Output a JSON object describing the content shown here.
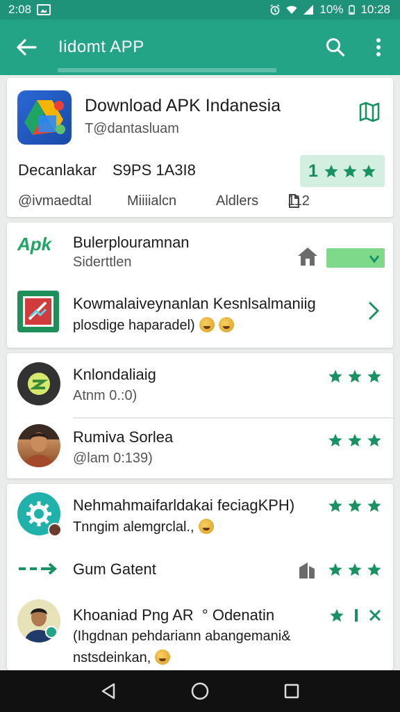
{
  "status_bar": {
    "time": "2:08",
    "battery": "10%",
    "clock": "10:28"
  },
  "appbar": {
    "title": "Iidomt APP"
  },
  "app": {
    "name": "Download APK Indanesia",
    "developer": "T@dantasluam",
    "stat_label": "Decanlakar",
    "stat_value": "S9PS 1A3I8",
    "rating": "1",
    "meta": [
      "@ivmaedtal",
      "Miiiialcn",
      "Aldlers",
      "112"
    ]
  },
  "section1": {
    "item1": {
      "badge": "Apk",
      "title": "Bulerplouramnan",
      "sub": "Siderttlen"
    },
    "item2": {
      "title": "Kowmalaiveynanlan Kesnlsalmaniig",
      "sub": "plosdige haparadel)"
    }
  },
  "section2": {
    "item1": {
      "title": "Knlondaliaig",
      "sub": "Atnm 0.:0)"
    },
    "item2": {
      "title": "Rumiva  Sorlea",
      "sub": "@lam 0:139)"
    }
  },
  "section3": {
    "item1": {
      "title": "Nehmahmaifarldakai feciagKPH)",
      "sub": "Tnngim alemgrclal.,"
    },
    "item2": {
      "title": "Gum Gatent"
    },
    "item3": {
      "title": "Khoaniad Png AR  ° Odenatin",
      "sub1": "(Ihgdnan pehdariann abangemani&",
      "sub2": "nstsdeinkan,"
    }
  },
  "colors": {
    "primary": "#23a487",
    "status": "#1f9379",
    "star": "#1a9163"
  }
}
